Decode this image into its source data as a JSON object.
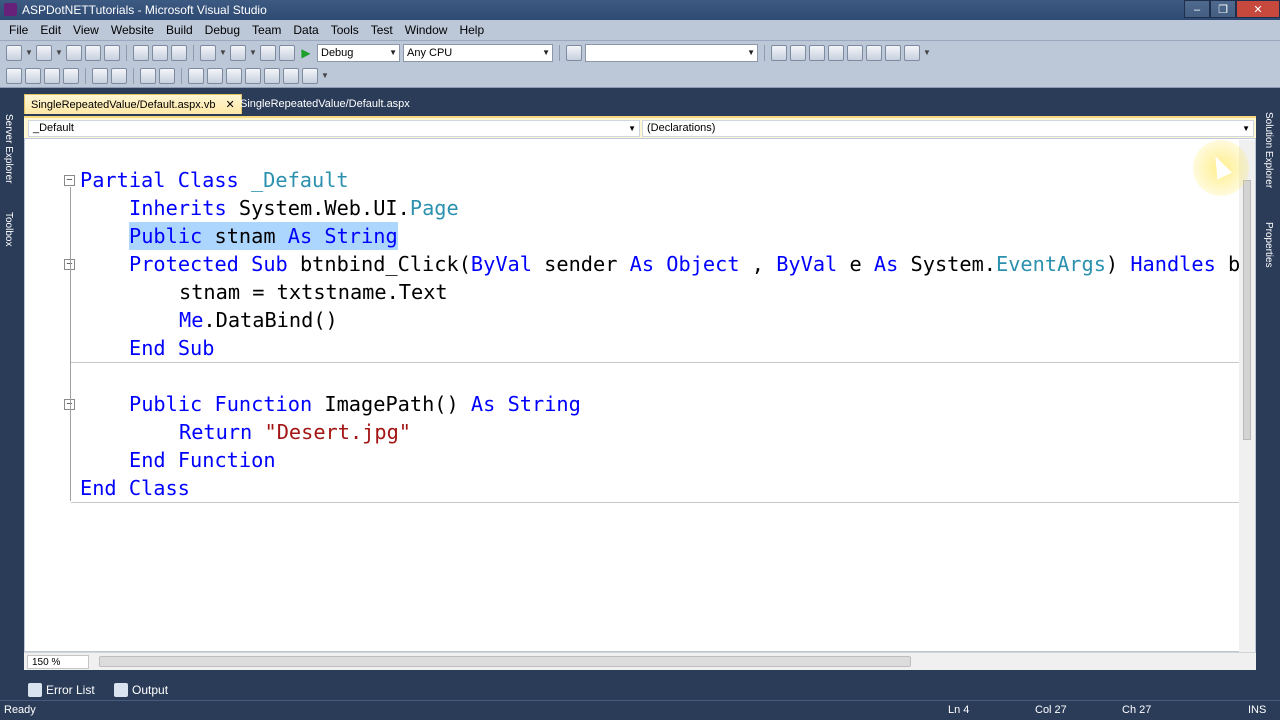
{
  "window": {
    "title": "ASPDotNETTutorials - Microsoft Visual Studio",
    "minimize": "‒",
    "maximize": "❐",
    "close": "✕"
  },
  "menu": [
    "File",
    "Edit",
    "View",
    "Website",
    "Build",
    "Debug",
    "Team",
    "Data",
    "Tools",
    "Test",
    "Window",
    "Help"
  ],
  "toolbar": {
    "configuration": "Debug",
    "platform": "Any CPU",
    "search": ""
  },
  "side_tabs": {
    "left_top": "Server Explorer",
    "left_bottom": "Toolbox",
    "right_top": "Solution Explorer",
    "right_bottom": "Properties"
  },
  "doc_tabs": [
    {
      "label": "SingleRepeatedValue/Default.aspx.vb",
      "active": true,
      "close": "✕"
    },
    {
      "label": "SingleRepeatedValue/Default.aspx",
      "active": false
    }
  ],
  "navigation": {
    "class_combo": "_Default",
    "member_combo": "(Declarations)"
  },
  "code": [
    {
      "indent": 0,
      "tokens": [
        [
          "kw",
          "Partial "
        ],
        [
          "kw",
          "Class "
        ],
        [
          "ty",
          "_Default"
        ]
      ]
    },
    {
      "indent": 1,
      "tokens": [
        [
          "kw",
          "Inherits "
        ],
        [
          "",
          "System.Web.UI."
        ],
        [
          "ty",
          "Page"
        ]
      ]
    },
    {
      "indent": 1,
      "tokens": [
        [
          "kw",
          "Public "
        ],
        [
          "",
          "stnam "
        ],
        [
          "kw",
          "As "
        ],
        [
          "kw",
          "String"
        ]
      ],
      "selected": true
    },
    {
      "indent": 1,
      "tokens": [
        [
          "kw",
          "Protected "
        ],
        [
          "kw",
          "Sub "
        ],
        [
          "",
          "btnbind_Click("
        ],
        [
          "kw",
          "ByVal "
        ],
        [
          "",
          "sender "
        ],
        [
          "kw",
          "As "
        ],
        [
          "kw",
          "Object"
        ],
        [
          "",
          " , "
        ],
        [
          "kw",
          "ByVal "
        ],
        [
          "",
          "e "
        ],
        [
          "kw",
          "As "
        ],
        [
          "",
          "System."
        ],
        [
          "ty",
          "EventArgs"
        ],
        [
          "",
          ") "
        ],
        [
          "kw",
          "Handles "
        ],
        [
          "",
          "b"
        ]
      ]
    },
    {
      "indent": 2,
      "tokens": [
        [
          "",
          "stnam = txtstname.Text"
        ]
      ]
    },
    {
      "indent": 2,
      "tokens": [
        [
          "kw",
          "Me"
        ],
        [
          "",
          ".DataBind()"
        ]
      ]
    },
    {
      "indent": 1,
      "tokens": [
        [
          "kw",
          "End "
        ],
        [
          "kw",
          "Sub"
        ]
      ]
    },
    {
      "indent": 0,
      "tokens": []
    },
    {
      "indent": 1,
      "tokens": [
        [
          "kw",
          "Public "
        ],
        [
          "kw",
          "Function "
        ],
        [
          "",
          "ImagePath() "
        ],
        [
          "kw",
          "As "
        ],
        [
          "kw",
          "String"
        ]
      ]
    },
    {
      "indent": 2,
      "tokens": [
        [
          "kw",
          "Return "
        ],
        [
          "st",
          "\"Desert.jpg\""
        ]
      ]
    },
    {
      "indent": 1,
      "tokens": [
        [
          "kw",
          "End "
        ],
        [
          "kw",
          "Function"
        ]
      ]
    },
    {
      "indent": 0,
      "tokens": [
        [
          "kw",
          "End "
        ],
        [
          "kw",
          "Class"
        ]
      ]
    }
  ],
  "editor": {
    "zoom": "150 %",
    "fold_marker": "−"
  },
  "bottom_tabs": [
    "Error List",
    "Output"
  ],
  "status": {
    "state": "Ready",
    "line": "Ln 4",
    "column": "Col 27",
    "char": "Ch 27",
    "mode": "INS"
  },
  "colors": {
    "keyword": "#0000ff",
    "type": "#2b91af",
    "string": "#a31515",
    "selection": "#add6ff",
    "chrome": "#2b3c59"
  }
}
